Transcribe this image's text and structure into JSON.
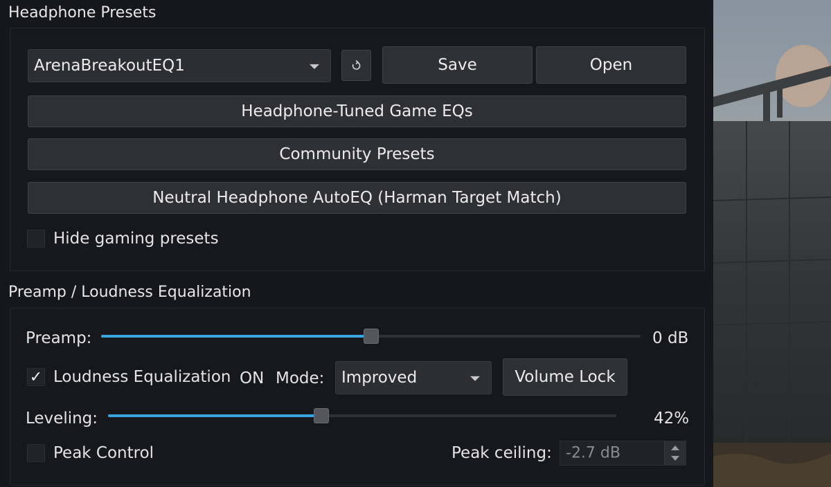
{
  "presets": {
    "section_title": "Headphone Presets",
    "selected_preset": "ArenaBreakoutEQ1",
    "save_label": "Save",
    "open_label": "Open",
    "game_eqs_label": "Headphone-Tuned Game EQs",
    "community_label": "Community Presets",
    "autoeq_label": "Neutral Headphone AutoEQ (Harman Target Match)",
    "hide_gaming_label": "Hide gaming presets",
    "hide_gaming_checked": false
  },
  "preamp": {
    "section_title": "Preamp / Loudness Equalization",
    "preamp_label": "Preamp:",
    "preamp_value_text": "0 dB",
    "preamp_fraction": 0.5,
    "loudness_label": "Loudness Equalization",
    "loudness_checked": true,
    "loudness_checkmark": "✓",
    "loudness_state": "ON",
    "mode_label": "Mode:",
    "mode_value": "Improved",
    "volume_lock_label": "Volume Lock",
    "leveling_label": "Leveling:",
    "leveling_value_text": "42%",
    "leveling_fraction": 0.42,
    "peak_control_label": "Peak Control",
    "peak_control_checked": false,
    "peak_ceiling_label": "Peak ceiling:",
    "peak_ceiling_value": "-2.7 dB"
  },
  "colors": {
    "accent": "#3aa6df",
    "panel_bg": "#16171d",
    "button_bg": "#2f3035"
  },
  "icons": {
    "refresh": "refresh-icon",
    "dropdown": "chevron-down-icon",
    "checkmark": "checkmark-icon"
  }
}
